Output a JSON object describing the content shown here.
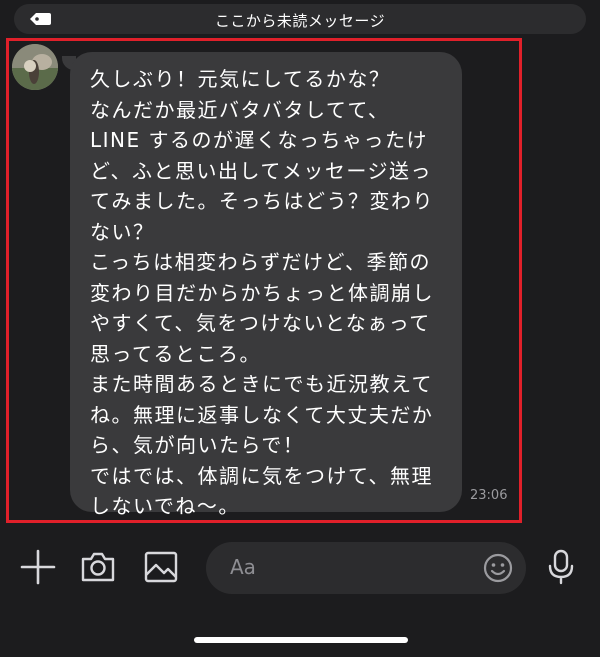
{
  "unread_divider": {
    "label": "ここから未読メッセージ",
    "icon": "tag-icon"
  },
  "message": {
    "text": "久しぶり！元気にしてるかな？\nなんだか最近バタバタしてて、\nLINE するのが遅くなっちゃったけど、ふと思い出してメッセージ送ってみました。そっちはどう？変わりない？\nこっちは相変わらずだけど、季節の変わり目だからかちょっと体調崩しやすくて、気をつけないとなぁって思ってるところ。\nまた時間あるときにでも近況教えてね。無理に返事しなくて大丈夫だから、気が向いたらで！\nではでは、体調に気をつけて、無理しないでね〜。",
    "time": "23:06"
  },
  "input_bar": {
    "placeholder": "Aa",
    "icons": [
      "plus-icon",
      "camera-icon",
      "image-icon",
      "emoji-icon",
      "microphone-icon"
    ]
  },
  "colors": {
    "background": "#1c1c1e",
    "bubble": "#3a3a3c",
    "highlight": "#e0202a",
    "text": "#ffffff",
    "muted": "#9b9b9f"
  }
}
